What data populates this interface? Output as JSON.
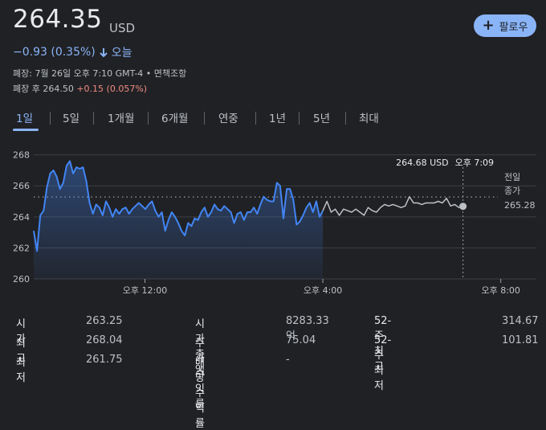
{
  "quote": {
    "price": "264.35",
    "currency": "USD",
    "change": "−0.93 (0.35%)",
    "period_label": "오늘",
    "meta": "폐장: 7월 26일 오후 7:10 GMT-4 • 면책조항",
    "after_hours_label": "폐장 후 264.50",
    "after_hours_change": "+0.15 (0.057%)"
  },
  "follow_button": {
    "label": "팔로우"
  },
  "tabs": [
    {
      "label": "1일",
      "active": true
    },
    {
      "label": "5일"
    },
    {
      "label": "1개월"
    },
    {
      "label": "6개월"
    },
    {
      "label": "연중"
    },
    {
      "label": "1년"
    },
    {
      "label": "5년"
    },
    {
      "label": "최대"
    }
  ],
  "chart_data": {
    "type": "line",
    "ylim": [
      260,
      268.5
    ],
    "yticks": [
      260,
      262,
      264,
      266,
      268
    ],
    "xticks": [
      {
        "t": 12,
        "label": "오후 12:00"
      },
      {
        "t": 16,
        "label": "오후 4:00"
      },
      {
        "t": 20,
        "label": "오후 8:00"
      }
    ],
    "x_range_hours": [
      9.5,
      20.8
    ],
    "previous_close": 265.28,
    "previous_close_label": [
      "전일",
      "종가",
      "265.28"
    ],
    "tooltip": {
      "price": "264.68 USD",
      "time": "오후 7:09",
      "t": 19.15,
      "value": 264.68
    },
    "colors": {
      "regular": "#4285f4",
      "extended": "#bdc1c6",
      "grid": "#3c4043"
    },
    "series": [
      {
        "session": "regular",
        "t_start": 9.5,
        "t_end": 16.0,
        "values": [
          263.1,
          261.8,
          264.1,
          264.4,
          265.9,
          266.8,
          267.0,
          266.6,
          265.8,
          266.2,
          267.3,
          267.6,
          266.8,
          267.2,
          267.1,
          267.2,
          266.3,
          264.9,
          264.2,
          264.8,
          264.6,
          264.1,
          265.0,
          264.6,
          264.0,
          264.5,
          264.2,
          264.5,
          264.6,
          264.2,
          264.5,
          264.7,
          264.9,
          264.7,
          264.5,
          264.8,
          265.0,
          264.4,
          264.0,
          264.3,
          263.1,
          263.8,
          264.3,
          264.0,
          263.6,
          263.1,
          262.8,
          263.6,
          263.4,
          263.9,
          263.8,
          264.3,
          264.6,
          264.0,
          264.3,
          264.8,
          264.5,
          264.4,
          264.7,
          264.5,
          264.3,
          263.6,
          264.2,
          264.3,
          263.8,
          264.3,
          264.3,
          264.6,
          264.2,
          264.8,
          265.3,
          265.1,
          265.0,
          265.0,
          266.2,
          266.0,
          263.9,
          265.8,
          265.8,
          265.1,
          263.5,
          263.7,
          264.1,
          264.6,
          264.9,
          264.3,
          265.0,
          264.0,
          264.4
        ]
      },
      {
        "session": "extended",
        "t_start": 16.0,
        "t_end": 19.15,
        "values": [
          264.4,
          265.0,
          264.3,
          264.5,
          264.1,
          264.5,
          264.4,
          264.3,
          264.5,
          264.3,
          264.1,
          264.6,
          264.4,
          264.3,
          264.6,
          264.8,
          264.7,
          264.8,
          264.7,
          264.6,
          264.7,
          265.3,
          264.9,
          264.9,
          264.8,
          264.9,
          264.9,
          264.9,
          265.0,
          264.9,
          265.2,
          264.7,
          264.8,
          264.6,
          264.68
        ]
      }
    ]
  },
  "stats": {
    "col1": [
      {
        "label": "시가",
        "value": "263.25"
      },
      {
        "label": "최고",
        "value": "268.04"
      },
      {
        "label": "최저",
        "value": "261.75"
      }
    ],
    "col2": [
      {
        "label": "시가총액",
        "value": "8283.33억"
      },
      {
        "label": "주가수익률",
        "value": "75.04"
      },
      {
        "label": "배당수익률",
        "value": "-"
      }
    ],
    "col3": [
      {
        "label": "52-주 최고",
        "value": "314.67"
      },
      {
        "label": "52-주 최저",
        "value": "101.81"
      }
    ]
  }
}
